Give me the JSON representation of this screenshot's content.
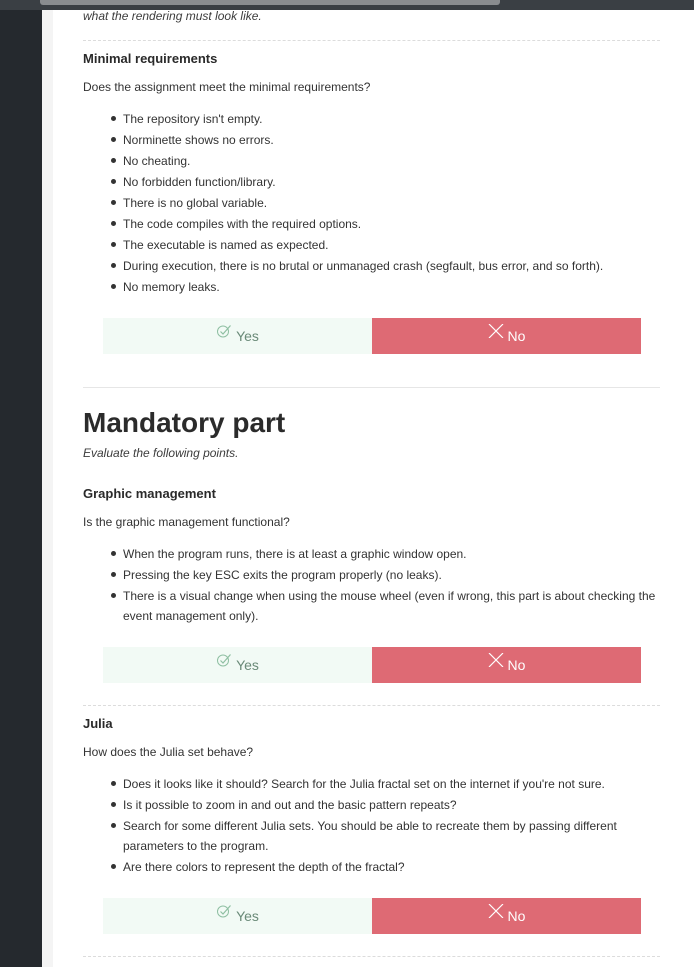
{
  "intro_note": "what the rendering must look like.",
  "sections": {
    "minimal": {
      "title": "Minimal requirements",
      "question": "Does the assignment meet the minimal requirements?",
      "items": [
        "The repository isn't empty.",
        "Norminette shows no errors.",
        "No cheating.",
        "No forbidden function/library.",
        "There is no global variable.",
        "The code compiles with the required options.",
        "The executable is named as expected.",
        "During execution, there is no brutal or unmanaged crash (segfault, bus error, and so forth).",
        "No memory leaks."
      ]
    },
    "mandatory": {
      "title": "Mandatory part",
      "subtitle": "Evaluate the following points."
    },
    "graphic": {
      "title": "Graphic management",
      "question": "Is the graphic management functional?",
      "items": [
        "When the program runs, there is at least a graphic window open.",
        "Pressing the key ESC exits the program properly (no leaks).",
        "There is a visual change when using the mouse wheel (even if wrong, this part is about checking the event management only)."
      ]
    },
    "julia": {
      "title": "Julia",
      "question": "How does the Julia set behave?",
      "items": [
        "Does it looks like it should? Search for the Julia fractal set on the internet if you're not sure.",
        "Is it possible to zoom in and out and the basic pattern repeats?",
        "Search for some different Julia sets. You should be able to recreate them by passing different parameters to the program.",
        "Are there colors to represent the depth of the fractal?"
      ]
    }
  },
  "buttons": {
    "yes_label": "Yes",
    "no_label": "No",
    "yes_icon": "check-icon",
    "no_icon": "cross-icon"
  },
  "colors": {
    "yes_bg": "#f2faf5",
    "no_bg": "#de6a74",
    "sidebar": "#25292e"
  }
}
